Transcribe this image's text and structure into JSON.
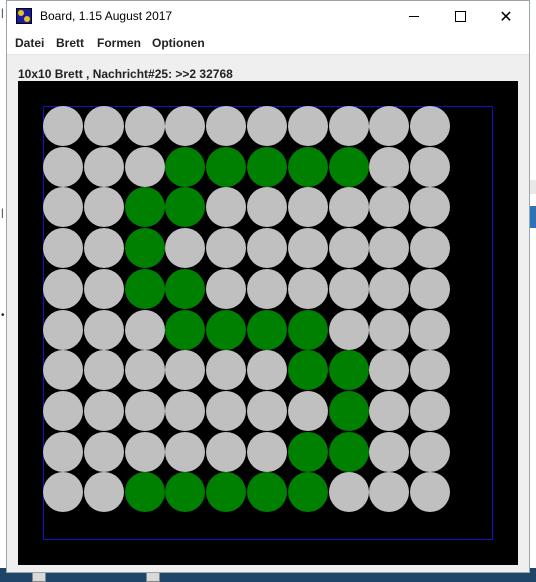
{
  "window": {
    "title": "Board, 1.15 August 2017"
  },
  "menu": {
    "items": [
      {
        "id": "datei",
        "label": "Datei"
      },
      {
        "id": "brett",
        "label": "Brett"
      },
      {
        "id": "formen",
        "label": "Formen"
      },
      {
        "id": "optionen",
        "label": "Optionen"
      }
    ]
  },
  "status": {
    "label": "10x10 Brett , Nachricht#25: >>2 32768"
  },
  "board": {
    "rows": 10,
    "cols": 10,
    "colors": {
      "off": "#c0c0c0",
      "on": "#008000",
      "background": "#000000",
      "frame": "#1111cc"
    },
    "cells": [
      [
        0,
        0,
        0,
        0,
        0,
        0,
        0,
        0,
        0,
        0
      ],
      [
        0,
        0,
        0,
        1,
        1,
        1,
        1,
        1,
        0,
        0
      ],
      [
        0,
        0,
        1,
        1,
        0,
        0,
        0,
        0,
        0,
        0
      ],
      [
        0,
        0,
        1,
        0,
        0,
        0,
        0,
        0,
        0,
        0
      ],
      [
        0,
        0,
        1,
        1,
        0,
        0,
        0,
        0,
        0,
        0
      ],
      [
        0,
        0,
        0,
        1,
        1,
        1,
        1,
        0,
        0,
        0
      ],
      [
        0,
        0,
        0,
        0,
        0,
        0,
        1,
        1,
        0,
        0
      ],
      [
        0,
        0,
        0,
        0,
        0,
        0,
        0,
        1,
        0,
        0
      ],
      [
        0,
        0,
        0,
        0,
        0,
        0,
        1,
        1,
        0,
        0
      ],
      [
        0,
        0,
        1,
        1,
        1,
        1,
        1,
        0,
        0,
        0
      ]
    ]
  }
}
